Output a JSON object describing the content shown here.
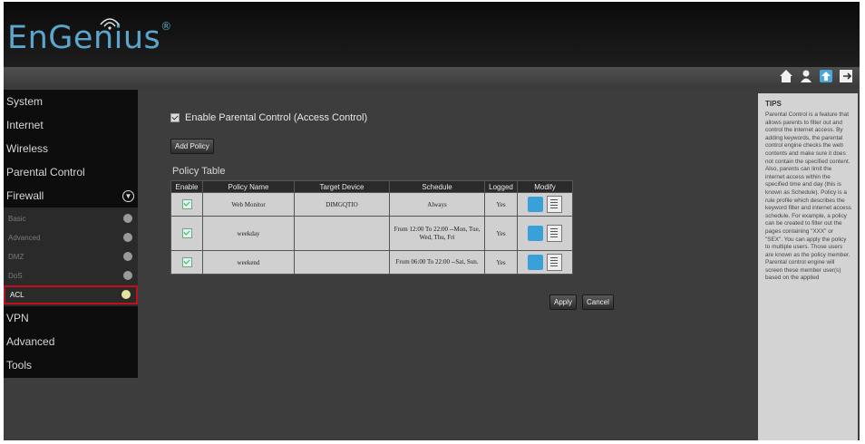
{
  "brand": {
    "logo_text": "EnGenius",
    "registered": "®"
  },
  "toolbar_icons": [
    "home-icon",
    "user-icon",
    "upload-icon",
    "logout-icon"
  ],
  "sidebar": {
    "items": [
      {
        "label": "System"
      },
      {
        "label": "Internet"
      },
      {
        "label": "Wireless"
      },
      {
        "label": "Parental Control"
      },
      {
        "label": "Firewall"
      }
    ],
    "firewall_sub": [
      {
        "label": "Basic"
      },
      {
        "label": "Advanced"
      },
      {
        "label": "DMZ"
      },
      {
        "label": "DoS"
      },
      {
        "label": "ACL"
      }
    ],
    "items_after": [
      {
        "label": "VPN"
      },
      {
        "label": "Advanced"
      },
      {
        "label": "Tools"
      }
    ]
  },
  "main": {
    "enable_label": "Enable Parental Control (Access Control)",
    "add_policy_label": "Add Policy",
    "policy_table_title": "Policy Table",
    "columns": [
      "Enable",
      "Policy Name",
      "Target Device",
      "Schedule",
      "Logged",
      "Modify"
    ],
    "rows": [
      {
        "name": "Web Monitor",
        "device": "DIMGQTIO",
        "schedule": "Always",
        "logged": "Yes"
      },
      {
        "name": "weekday",
        "device": "",
        "schedule": "From 12:00 To 22:00 --Mon, Tue, Wed, Thu, Fri",
        "logged": "Yes"
      },
      {
        "name": "weekend",
        "device": "",
        "schedule": "From 06:00 To 22:00 --Sat, Sun.",
        "logged": "Yes"
      }
    ],
    "apply_label": "Apply",
    "cancel_label": "Cancel"
  },
  "tips": {
    "title": "TIPS",
    "body": "Parental Control is a feature that allows parents to filter out and control the internet access. By adding keywords, the parental control engine checks the web contents and make sure it does not contain the specified content. Also, parents can limit the internet access within the specified time and day (this is known as Schedule). Policy is a rule profile which describes the keyword filter and internet access schedule. For example, a policy can be created to filter out the pages containing \"XXX\" or \"SEX\". You can apply the policy to multiple users. Those users are known as the policy member. Parental control engine will screen these member user(s) based on the applied"
  }
}
